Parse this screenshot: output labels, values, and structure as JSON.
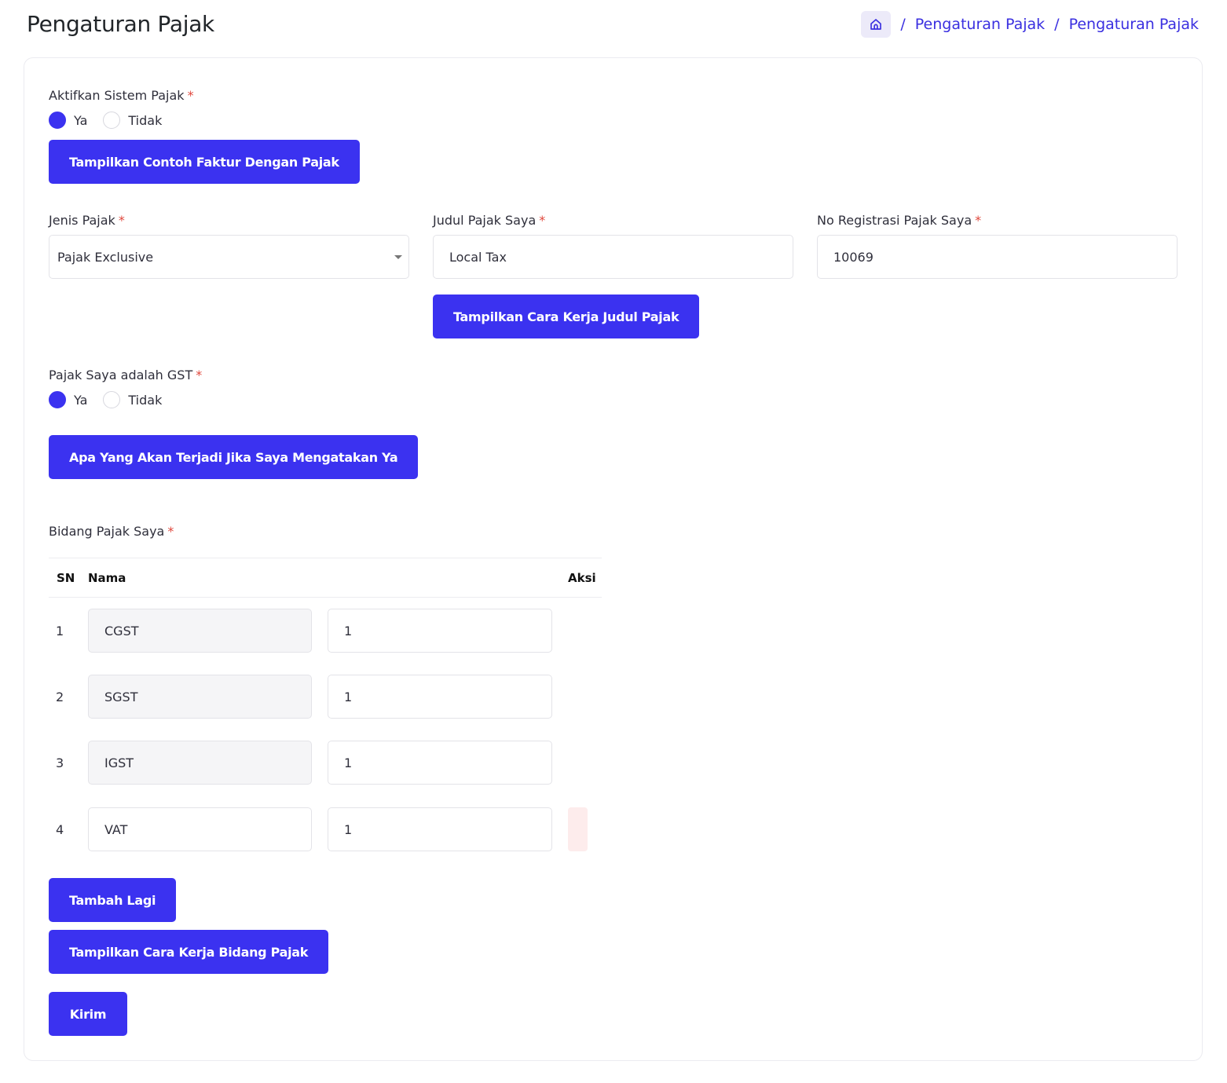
{
  "header": {
    "title": "Pengaturan Pajak",
    "breadcrumb": [
      "Pengaturan Pajak",
      "Pengaturan Pajak"
    ],
    "separator": "/"
  },
  "enable_tax": {
    "label": "Aktifkan Sistem Pajak",
    "required": "*",
    "options": [
      "Ya",
      "Tidak"
    ],
    "selected": "Ya"
  },
  "sample_invoice_button": "Tampilkan Contoh Faktur Dengan Pajak",
  "tax_type": {
    "label": "Jenis Pajak",
    "value": "Pajak Exclusive"
  },
  "tax_title": {
    "label": "Judul Pajak Saya",
    "value": "Local Tax"
  },
  "tax_reg_no": {
    "label": "No Registrasi Pajak Saya",
    "value": "10069"
  },
  "title_howto_button": "Tampilkan Cara Kerja Judul Pajak",
  "gst": {
    "label": "Pajak Saya adalah GST",
    "options": [
      "Ya",
      "Tidak"
    ],
    "selected": "Ya"
  },
  "gst_info_button": "Apa Yang Akan Terjadi Jika Saya Mengatakan Ya",
  "tax_fields": {
    "label": "Bidang Pajak Saya",
    "columns": [
      "SN",
      "Nama",
      "Aksi"
    ],
    "rows": [
      {
        "sn": "1",
        "name": "CGST",
        "value": "1"
      },
      {
        "sn": "2",
        "name": "SGST",
        "value": "1"
      },
      {
        "sn": "3",
        "name": "IGST",
        "value": "1"
      },
      {
        "sn": "4",
        "name": "VAT",
        "value": "1"
      }
    ]
  },
  "add_more_button": "Tambah Lagi",
  "fields_howto_button": "Tampilkan Cara Kerja Bidang Pajak",
  "submit_button": "Kirim",
  "colors": {
    "primary": "#3b32f0",
    "required": "#e0473c",
    "link": "#3a2fe0"
  }
}
